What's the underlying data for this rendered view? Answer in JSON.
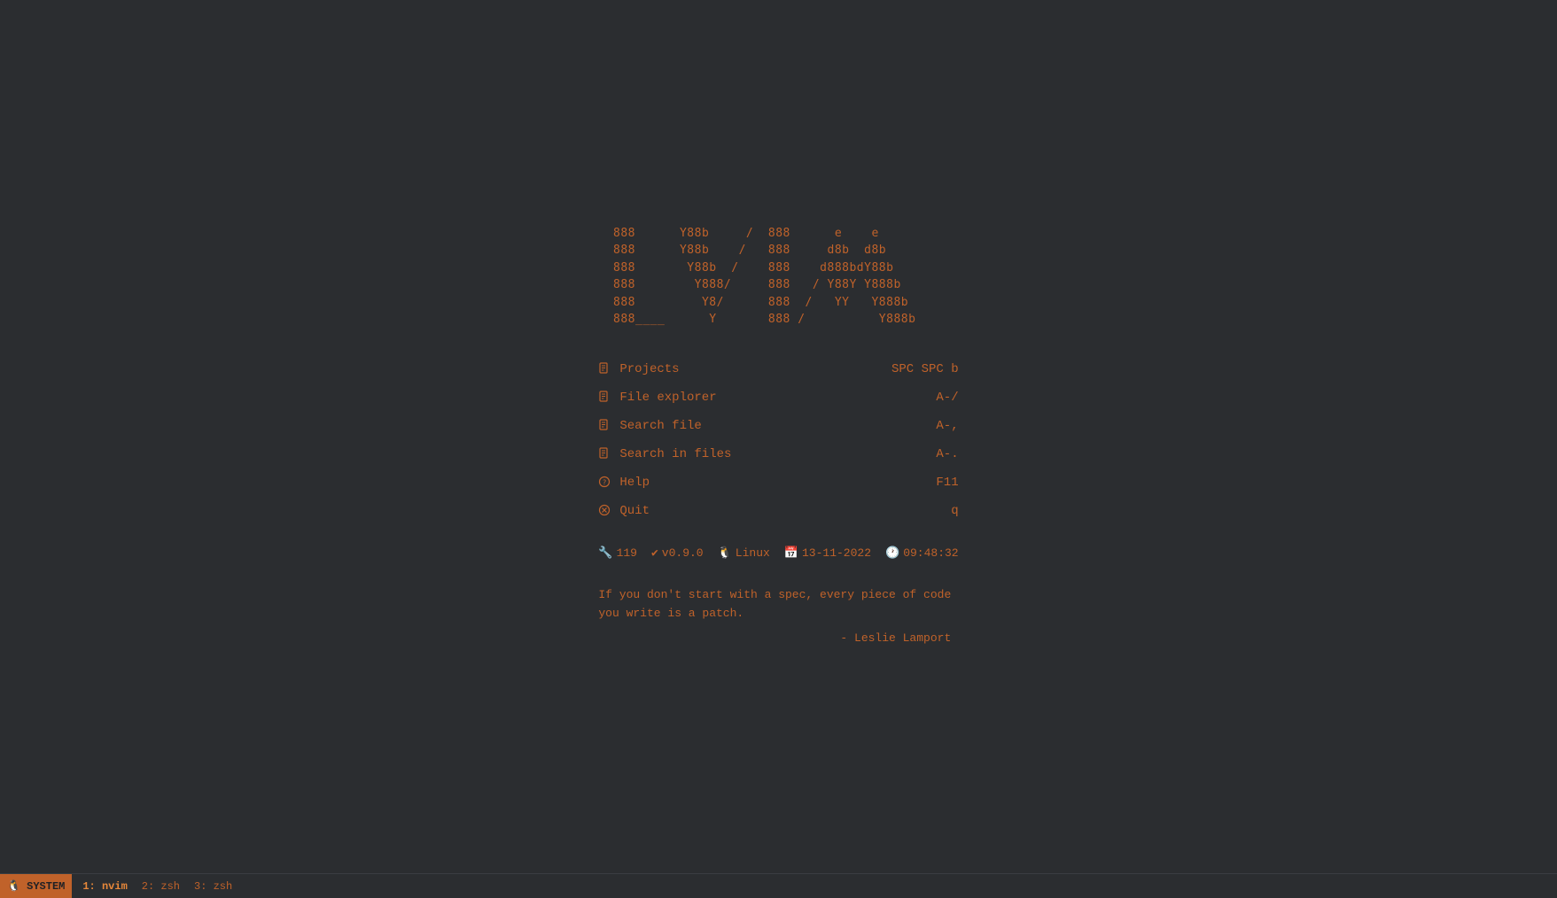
{
  "ascii_art": {
    "lines": [
      "  888      Y88b     /  888      e    e",
      "  888      Y88b    /   888     d8b  d8b",
      "  888       Y88b  /    888    d888bdY88b",
      "  888        Y888/     888   / Y88Y Y888b",
      "  888         Y8/      888  /   YY   Y888b",
      "  888____      Y       888 /          Y888b"
    ]
  },
  "menu": {
    "items": [
      {
        "id": "projects",
        "icon": "doc-icon",
        "label": "Projects",
        "shortcut": "SPC SPC b"
      },
      {
        "id": "file-explorer",
        "icon": "doc-icon",
        "label": "File explorer",
        "shortcut": "A-/"
      },
      {
        "id": "search-file",
        "icon": "doc-icon",
        "label": "Search file",
        "shortcut": "A-,"
      },
      {
        "id": "search-in-files",
        "icon": "doc-icon",
        "label": "Search in files",
        "shortcut": "A-."
      },
      {
        "id": "help",
        "icon": "question-icon",
        "label": "Help",
        "shortcut": "F11"
      },
      {
        "id": "quit",
        "icon": "circle-x-icon",
        "label": "Quit",
        "shortcut": "q"
      }
    ]
  },
  "status": {
    "wrench_icon": "🔧",
    "count": "119",
    "checkmark_icon": "✔",
    "version": "v0.9.0",
    "linux_icon": "🐧",
    "os": "Linux",
    "calendar_icon": "📅",
    "date": "13-11-2022",
    "clock_icon": "🕐",
    "time": "09:48:32"
  },
  "quote": {
    "text": "If you don't start with a spec, every piece of code\nyou write is a patch.",
    "attribution": "- Leslie Lamport"
  },
  "bottom_bar": {
    "system_label": "🐧 SYSTEM",
    "windows": [
      {
        "id": 1,
        "label": "1: nvim",
        "active": true
      },
      {
        "id": 2,
        "label": "2: zsh",
        "active": false
      },
      {
        "id": 3,
        "label": "3: zsh",
        "active": false
      }
    ]
  },
  "colors": {
    "accent": "#c0622a",
    "bg": "#2b2d30",
    "text": "#c0622a"
  }
}
